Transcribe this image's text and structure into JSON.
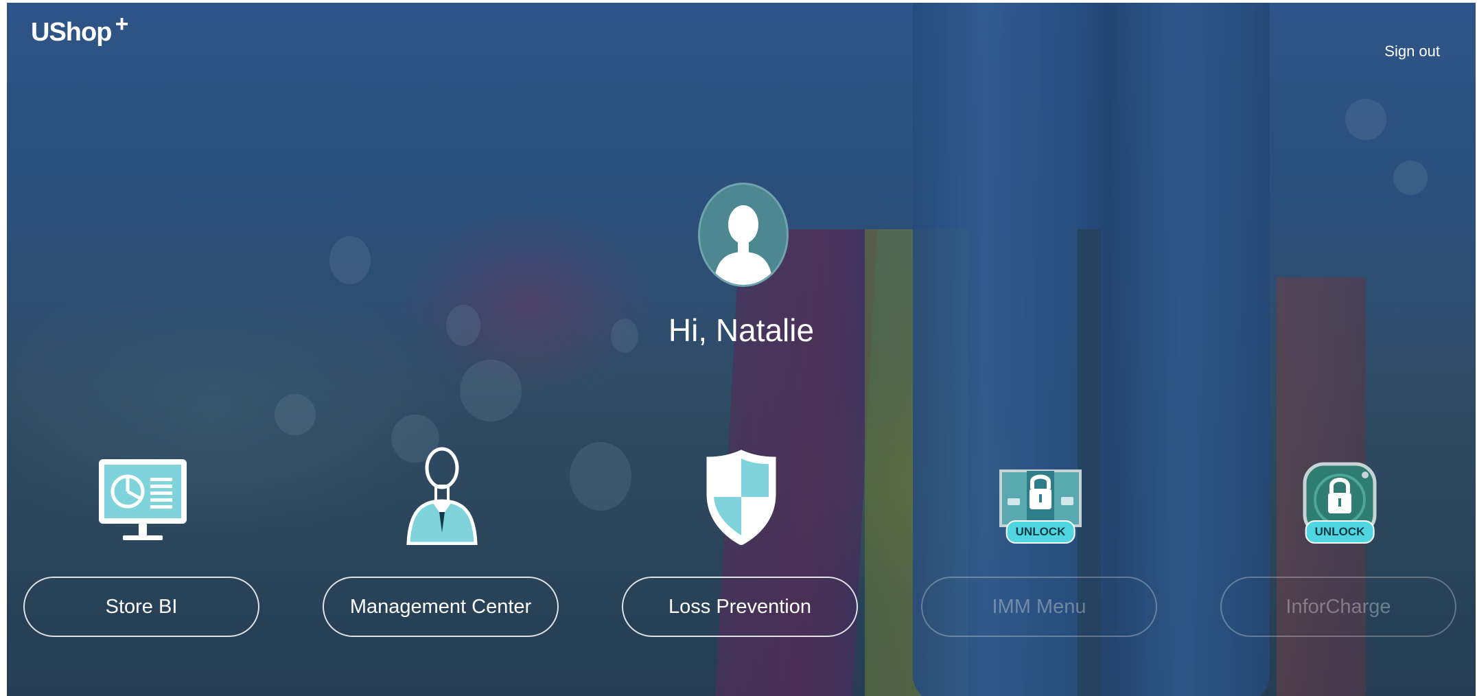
{
  "header": {
    "logo_text": "UShop",
    "logo_plus": "+",
    "sign_out_label": "Sign out"
  },
  "user": {
    "greeting": "Hi, Natalie"
  },
  "apps": [
    {
      "label": "Store BI",
      "icon": "monitor-chart-icon",
      "locked": false
    },
    {
      "label": "Management Center",
      "icon": "manager-icon",
      "locked": false
    },
    {
      "label": "Loss Prevention",
      "icon": "shield-icon",
      "locked": false
    },
    {
      "label": "IMM Menu",
      "icon": "lock-menu-icon",
      "locked": true,
      "badge": "UNLOCK"
    },
    {
      "label": "InforCharge",
      "icon": "lock-icon",
      "locked": true,
      "badge": "UNLOCK"
    }
  ],
  "colors": {
    "accent": "#4fd6e0",
    "icon_fill": "#7fd4dc"
  }
}
